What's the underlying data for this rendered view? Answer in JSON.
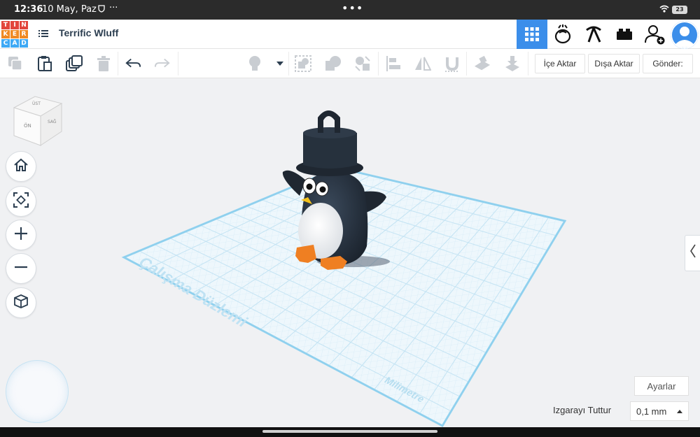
{
  "status_bar": {
    "time": "12:36",
    "date": "10 May, Paz",
    "more": "···",
    "center_dots": "•••",
    "battery": "23"
  },
  "header": {
    "logo_letters": [
      "T",
      "I",
      "N",
      "K",
      "E",
      "R",
      "C",
      "A",
      "D"
    ],
    "logo_colors": [
      "#e2453c",
      "#e2453c",
      "#e2453c",
      "#f08a24",
      "#f08a24",
      "#f08a24",
      "#3fa9f5",
      "#3fa9f5",
      "#3fa9f5"
    ],
    "project_title": "Terrific Wluff",
    "accent": "#3b8eea",
    "buttons": [
      {
        "name": "3d-view-grid-icon",
        "active": true
      },
      {
        "name": "blocks-icon",
        "active": false
      },
      {
        "name": "pickaxe-icon",
        "active": false
      },
      {
        "name": "brick-icon",
        "active": false
      },
      {
        "name": "invite-user-icon",
        "active": false
      }
    ]
  },
  "toolbar": {
    "import_label": "İçe Aktar",
    "export_label": "Dışa Aktar",
    "send_label": "Gönder:"
  },
  "viewcube": {
    "top": "ÜST",
    "front": "ÖN",
    "right": "SAĞ"
  },
  "workplane": {
    "label": "Çalışma Düzlemi",
    "units": "Milimetre",
    "grid_color": "#cde8f5",
    "edge_color": "#8fd0ee"
  },
  "bottom": {
    "settings_label": "Ayarlar",
    "snap_label": "Izgarayı Tuttur",
    "snap_value": "0,1 mm"
  }
}
